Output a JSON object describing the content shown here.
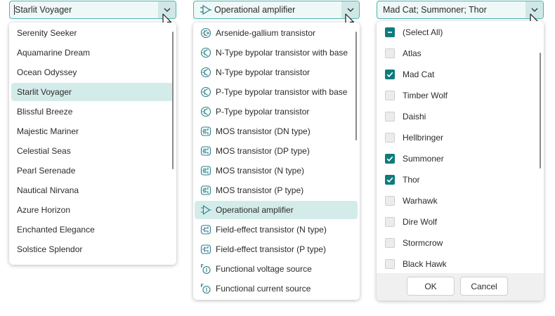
{
  "combo1": {
    "value": "Starlit Voyager",
    "items": [
      "Serenity Seeker",
      "Aquamarine Dream",
      "Ocean Odyssey",
      "Starlit Voyager",
      "Blissful Breeze",
      "Majestic Mariner",
      "Celestial Seas",
      "Pearl Serenade",
      "Nautical Nirvana",
      "Azure Horizon",
      "Enchanted Elegance",
      "Solstice Splendor"
    ],
    "selected_index": 3
  },
  "combo2": {
    "value": "Operational amplifier",
    "value_icon": "op-amp-icon",
    "items": [
      {
        "label": "Arsenide-gallium transistor",
        "icon": "gaas-transistor-icon"
      },
      {
        "label": "N-Type bypolar transistor with base",
        "icon": "npn-base-transistor-icon"
      },
      {
        "label": "N-Type bypolar transistor",
        "icon": "npn-transistor-icon"
      },
      {
        "label": "P-Type bypolar transistor with base",
        "icon": "pnp-base-transistor-icon"
      },
      {
        "label": "P-Type bypolar transistor",
        "icon": "pnp-transistor-icon"
      },
      {
        "label": "MOS transistor (DN type)",
        "icon": "mos-dn-transistor-icon"
      },
      {
        "label": "MOS transistor (DP type)",
        "icon": "mos-dp-transistor-icon"
      },
      {
        "label": "MOS transistor (N type)",
        "icon": "mos-n-transistor-icon"
      },
      {
        "label": "MOS transistor (P type)",
        "icon": "mos-p-transistor-icon"
      },
      {
        "label": "Operational amplifier",
        "icon": "op-amp-icon"
      },
      {
        "label": "Field-effect transistor (N type)",
        "icon": "fet-n-transistor-icon"
      },
      {
        "label": "Field-effect transistor (P type)",
        "icon": "fet-p-transistor-icon"
      },
      {
        "label": "Functional voltage source",
        "icon": "voltage-source-icon"
      },
      {
        "label": "Functional current source",
        "icon": "current-source-icon"
      }
    ],
    "selected_index": 9
  },
  "combo3": {
    "value": "Mad Cat; Summoner; Thor",
    "items": [
      {
        "label": "(Select All)",
        "state": "partial"
      },
      {
        "label": "Atlas",
        "state": "off"
      },
      {
        "label": "Mad Cat",
        "state": "on"
      },
      {
        "label": "Timber Wolf",
        "state": "off"
      },
      {
        "label": "Daishi",
        "state": "off"
      },
      {
        "label": "Hellbringer",
        "state": "off"
      },
      {
        "label": "Summoner",
        "state": "on"
      },
      {
        "label": "Thor",
        "state": "on"
      },
      {
        "label": "Warhawk",
        "state": "off"
      },
      {
        "label": "Dire Wolf",
        "state": "off"
      },
      {
        "label": "Stormcrow",
        "state": "off"
      },
      {
        "label": "Black Hawk",
        "state": "off"
      }
    ],
    "ok_label": "OK",
    "cancel_label": "Cancel"
  },
  "colors": {
    "accent": "#0e7c7b",
    "icon": "#2a7f8a",
    "selection": "#d3ecea",
    "combo_border": "#4fb3ad"
  }
}
